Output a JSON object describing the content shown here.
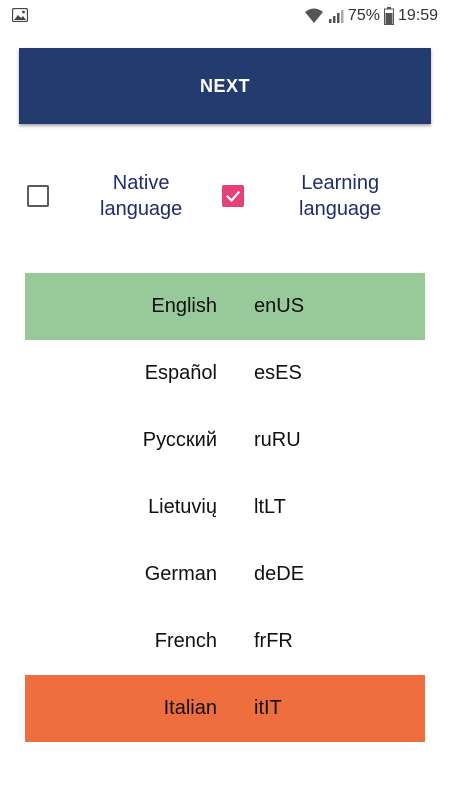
{
  "status_bar": {
    "battery_percent": "75%",
    "time": "19:59",
    "icons": [
      "image-icon",
      "wifi-icon",
      "signal-icon",
      "battery-icon"
    ]
  },
  "next_button": {
    "label": "NEXT",
    "color": "#233b6e"
  },
  "options": {
    "native": {
      "line1": "Native",
      "line2": "language",
      "checked": false
    },
    "learning": {
      "line1": "Learning",
      "line2": "language",
      "checked": true,
      "color": "#e8407a"
    }
  },
  "languages": [
    {
      "name": "English",
      "code": "enUS",
      "highlight": "#98c99a"
    },
    {
      "name": "Español",
      "code": "esES",
      "highlight": ""
    },
    {
      "name": "Русский",
      "code": "ruRU",
      "highlight": ""
    },
    {
      "name": "Lietuvių",
      "code": "ltLT",
      "highlight": ""
    },
    {
      "name": "German",
      "code": "deDE",
      "highlight": ""
    },
    {
      "name": "French",
      "code": "frFR",
      "highlight": ""
    },
    {
      "name": "Italian",
      "code": "itIT",
      "highlight": "#ee6e3d"
    }
  ]
}
